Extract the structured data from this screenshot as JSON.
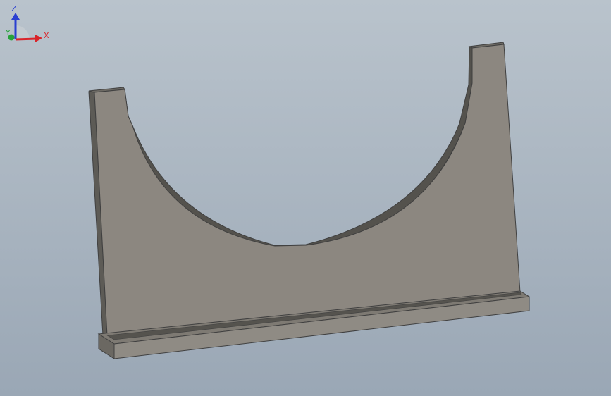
{
  "viewport": {
    "background_top": "#b9c3cc",
    "background_bottom": "#9aa7b5"
  },
  "part": {
    "face_color": "#8c8780",
    "edge_color": "#404040",
    "side_color": "#5d5b56",
    "base_top_color": "#7e7a73",
    "base_front_color": "#8f8b84"
  },
  "triad": {
    "z_label": "Z",
    "y_label": "Y",
    "x_label": "X",
    "z_color": "#2a3fd1",
    "x_color": "#d9242a",
    "y_color": "#27a33a"
  }
}
